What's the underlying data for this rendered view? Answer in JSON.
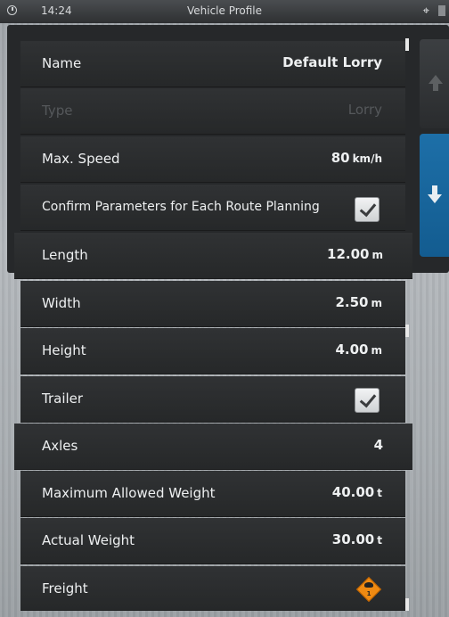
{
  "status_bar": {
    "time": "14:24",
    "title": "Vehicle Profile"
  },
  "colors": {
    "accent_blue": "#1d6fa8",
    "row_bg": "#2b2d2f",
    "hazard_orange": "#ef8a12"
  },
  "rows": [
    {
      "label": "Name",
      "value": "Default Lorry",
      "unit": ""
    },
    {
      "label": "Type",
      "value": "Lorry",
      "unit": ""
    },
    {
      "label": "Max. Speed",
      "value": "80",
      "unit": "km/h"
    },
    {
      "label": "Confirm Parameters for Each Route Planning",
      "checked": true
    },
    {
      "label": "Length",
      "value": "12.00",
      "unit": "m"
    },
    {
      "label": "Width",
      "value": "2.50",
      "unit": "m"
    },
    {
      "label": "Height",
      "value": "4.00",
      "unit": "m"
    },
    {
      "label": "Trailer",
      "checked": true
    },
    {
      "label": "Axles",
      "value": "4",
      "unit": ""
    },
    {
      "label": "Maximum Allowed Weight",
      "value": "40.00",
      "unit": "t"
    },
    {
      "label": "Actual Weight",
      "value": "30.00",
      "unit": "t"
    },
    {
      "label": "Freight",
      "icon": "explosive-hazard-icon",
      "hazard_class": "1"
    }
  ]
}
